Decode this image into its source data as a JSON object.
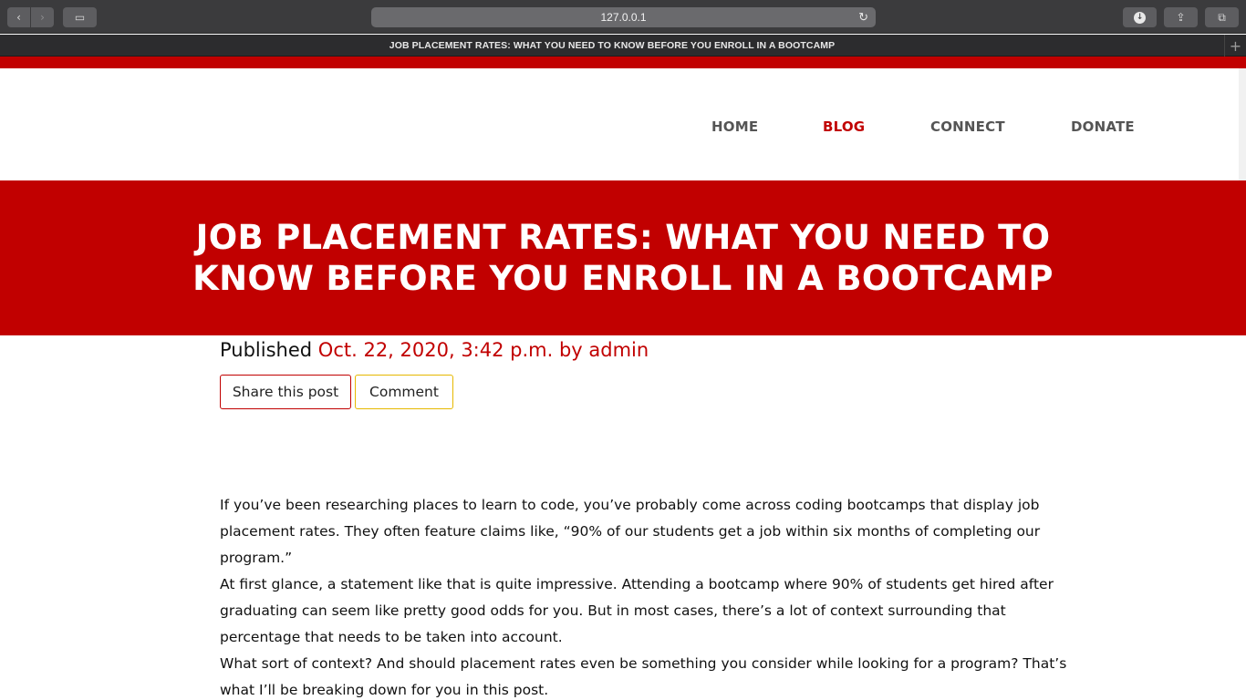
{
  "browser": {
    "url": "127.0.0.1",
    "tab_title": "JOB PLACEMENT RATES: WHAT YOU NEED TO KNOW BEFORE YOU ENROLL IN A BOOTCAMP",
    "icons": {
      "back": "‹",
      "forward": "›",
      "sidebar": "▭",
      "reload": "↻",
      "download": "↓",
      "share": "⇪",
      "tabs": "⧉",
      "new_tab": "+"
    }
  },
  "nav": {
    "items": [
      {
        "label": "HOME"
      },
      {
        "label": "BLOG",
        "active": true
      },
      {
        "label": "CONNECT"
      },
      {
        "label": "DONATE"
      }
    ],
    "active_color": "#c10000"
  },
  "hero": {
    "title": "JOB PLACEMENT RATES: WHAT YOU NEED TO KNOW BEFORE YOU ENROLL IN A BOOTCAMP",
    "background_color": "#c10000"
  },
  "post": {
    "published_label": "Published",
    "published_meta": "Oct. 22, 2020, 3:42 p.m. by admin",
    "share_label": "Share this post",
    "comment_label": "Comment",
    "paragraphs": [
      "If you’ve been researching places to learn to code, you’ve probably come across coding bootcamps that display job placement rates. They often feature claims like, “90% of our students get a job within six months of completing our program.”",
      "At first glance, a statement like that is quite impressive. Attending a bootcamp where 90% of students get hired after graduating can seem like pretty good odds for you. But in most cases, there’s a lot of context surrounding that percentage that needs to be taken into account.",
      "What sort of context? And should placement rates even be something you consider while looking for a program? That’s what I’ll be breaking down for you in this post."
    ]
  }
}
